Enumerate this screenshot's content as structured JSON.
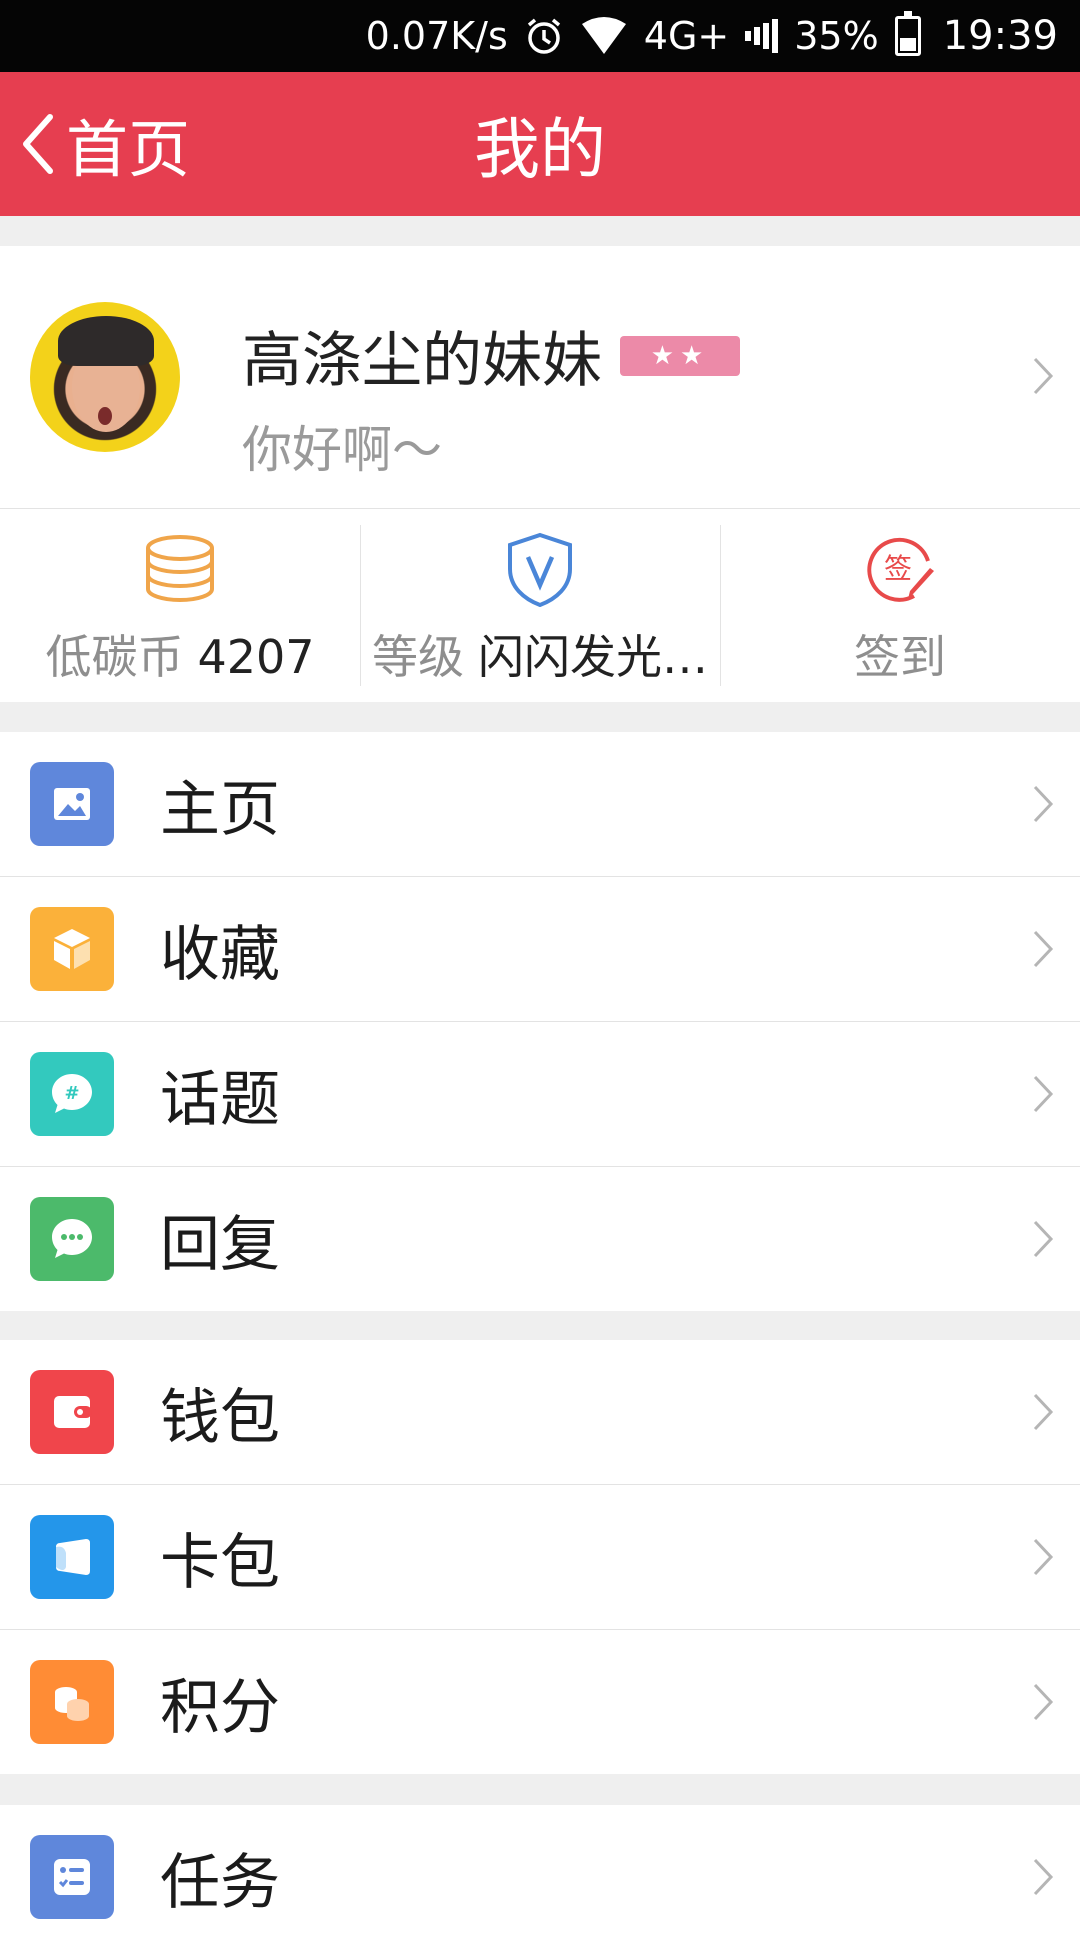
{
  "status_bar": {
    "net_speed": "0.07K/s",
    "network": "4G+",
    "battery": "35%",
    "time": "19:39"
  },
  "app_bar": {
    "back_label": "首页",
    "title": "我的"
  },
  "profile": {
    "username": "高涤尘的妹妹",
    "badge": "★★",
    "bio": "你好啊～"
  },
  "stats": {
    "coins_label": "低碳币",
    "coins_value": "4207",
    "level_label": "等级",
    "level_value": "闪闪发光…",
    "checkin_label": "签到"
  },
  "menu_group_1": [
    {
      "label": "主页",
      "icon": "image-icon",
      "color": "#5f87db"
    },
    {
      "label": "收藏",
      "icon": "box-icon",
      "color": "#fbb13a"
    },
    {
      "label": "话题",
      "icon": "hashtag-bubble-icon",
      "color": "#33c9be"
    },
    {
      "label": "回复",
      "icon": "chat-bubble-icon",
      "color": "#4cba6b"
    }
  ],
  "menu_group_2": [
    {
      "label": "钱包",
      "icon": "wallet-icon",
      "color": "#f0454b"
    },
    {
      "label": "卡包",
      "icon": "card-icon",
      "color": "#2496ea"
    },
    {
      "label": "积分",
      "icon": "coins-icon",
      "color": "#ff8c35"
    }
  ],
  "menu_group_3": [
    {
      "label": "任务",
      "icon": "task-list-icon",
      "color": "#5f87db"
    }
  ],
  "colors": {
    "accent": "#e63e50",
    "background": "#efefef"
  }
}
